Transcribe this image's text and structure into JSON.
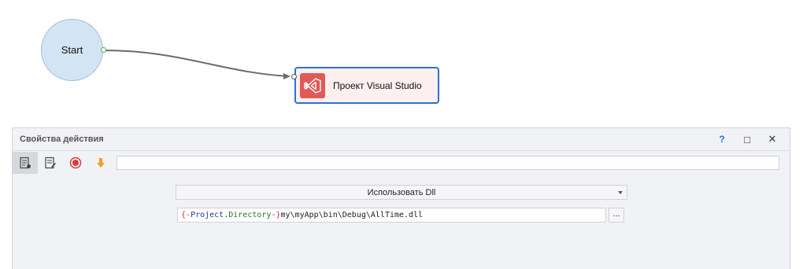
{
  "canvas": {
    "start_node": {
      "label": "Start",
      "fill": "#d3e5f5"
    },
    "action_node": {
      "label": "Проект Visual Studio",
      "icon": "visual-studio-icon",
      "icon_color": "#e05a5a",
      "border_color": "#2f6fd6"
    }
  },
  "panel": {
    "title": "Свойства действия",
    "header_buttons": {
      "help": "?",
      "maximize": "□",
      "close": "✕"
    },
    "toolbar": {
      "icons": [
        "properties-icon",
        "edit-properties-icon",
        "record-icon",
        "download-arrow-icon"
      ],
      "filter_value": ""
    },
    "mode_select": {
      "value": "Использовать Dll"
    },
    "path_field": {
      "brace_open": "{",
      "dash1": "-",
      "project": "Project",
      "dot": ".",
      "directory": "Directory",
      "dash2": "-",
      "brace_close": "}",
      "rest": "my\\myApp\\bin\\Debug\\AllTime.dll"
    },
    "browse_label": "..."
  },
  "colors": {
    "accent": "#2f6fd6",
    "panel_bg": "#f1f2f6"
  }
}
